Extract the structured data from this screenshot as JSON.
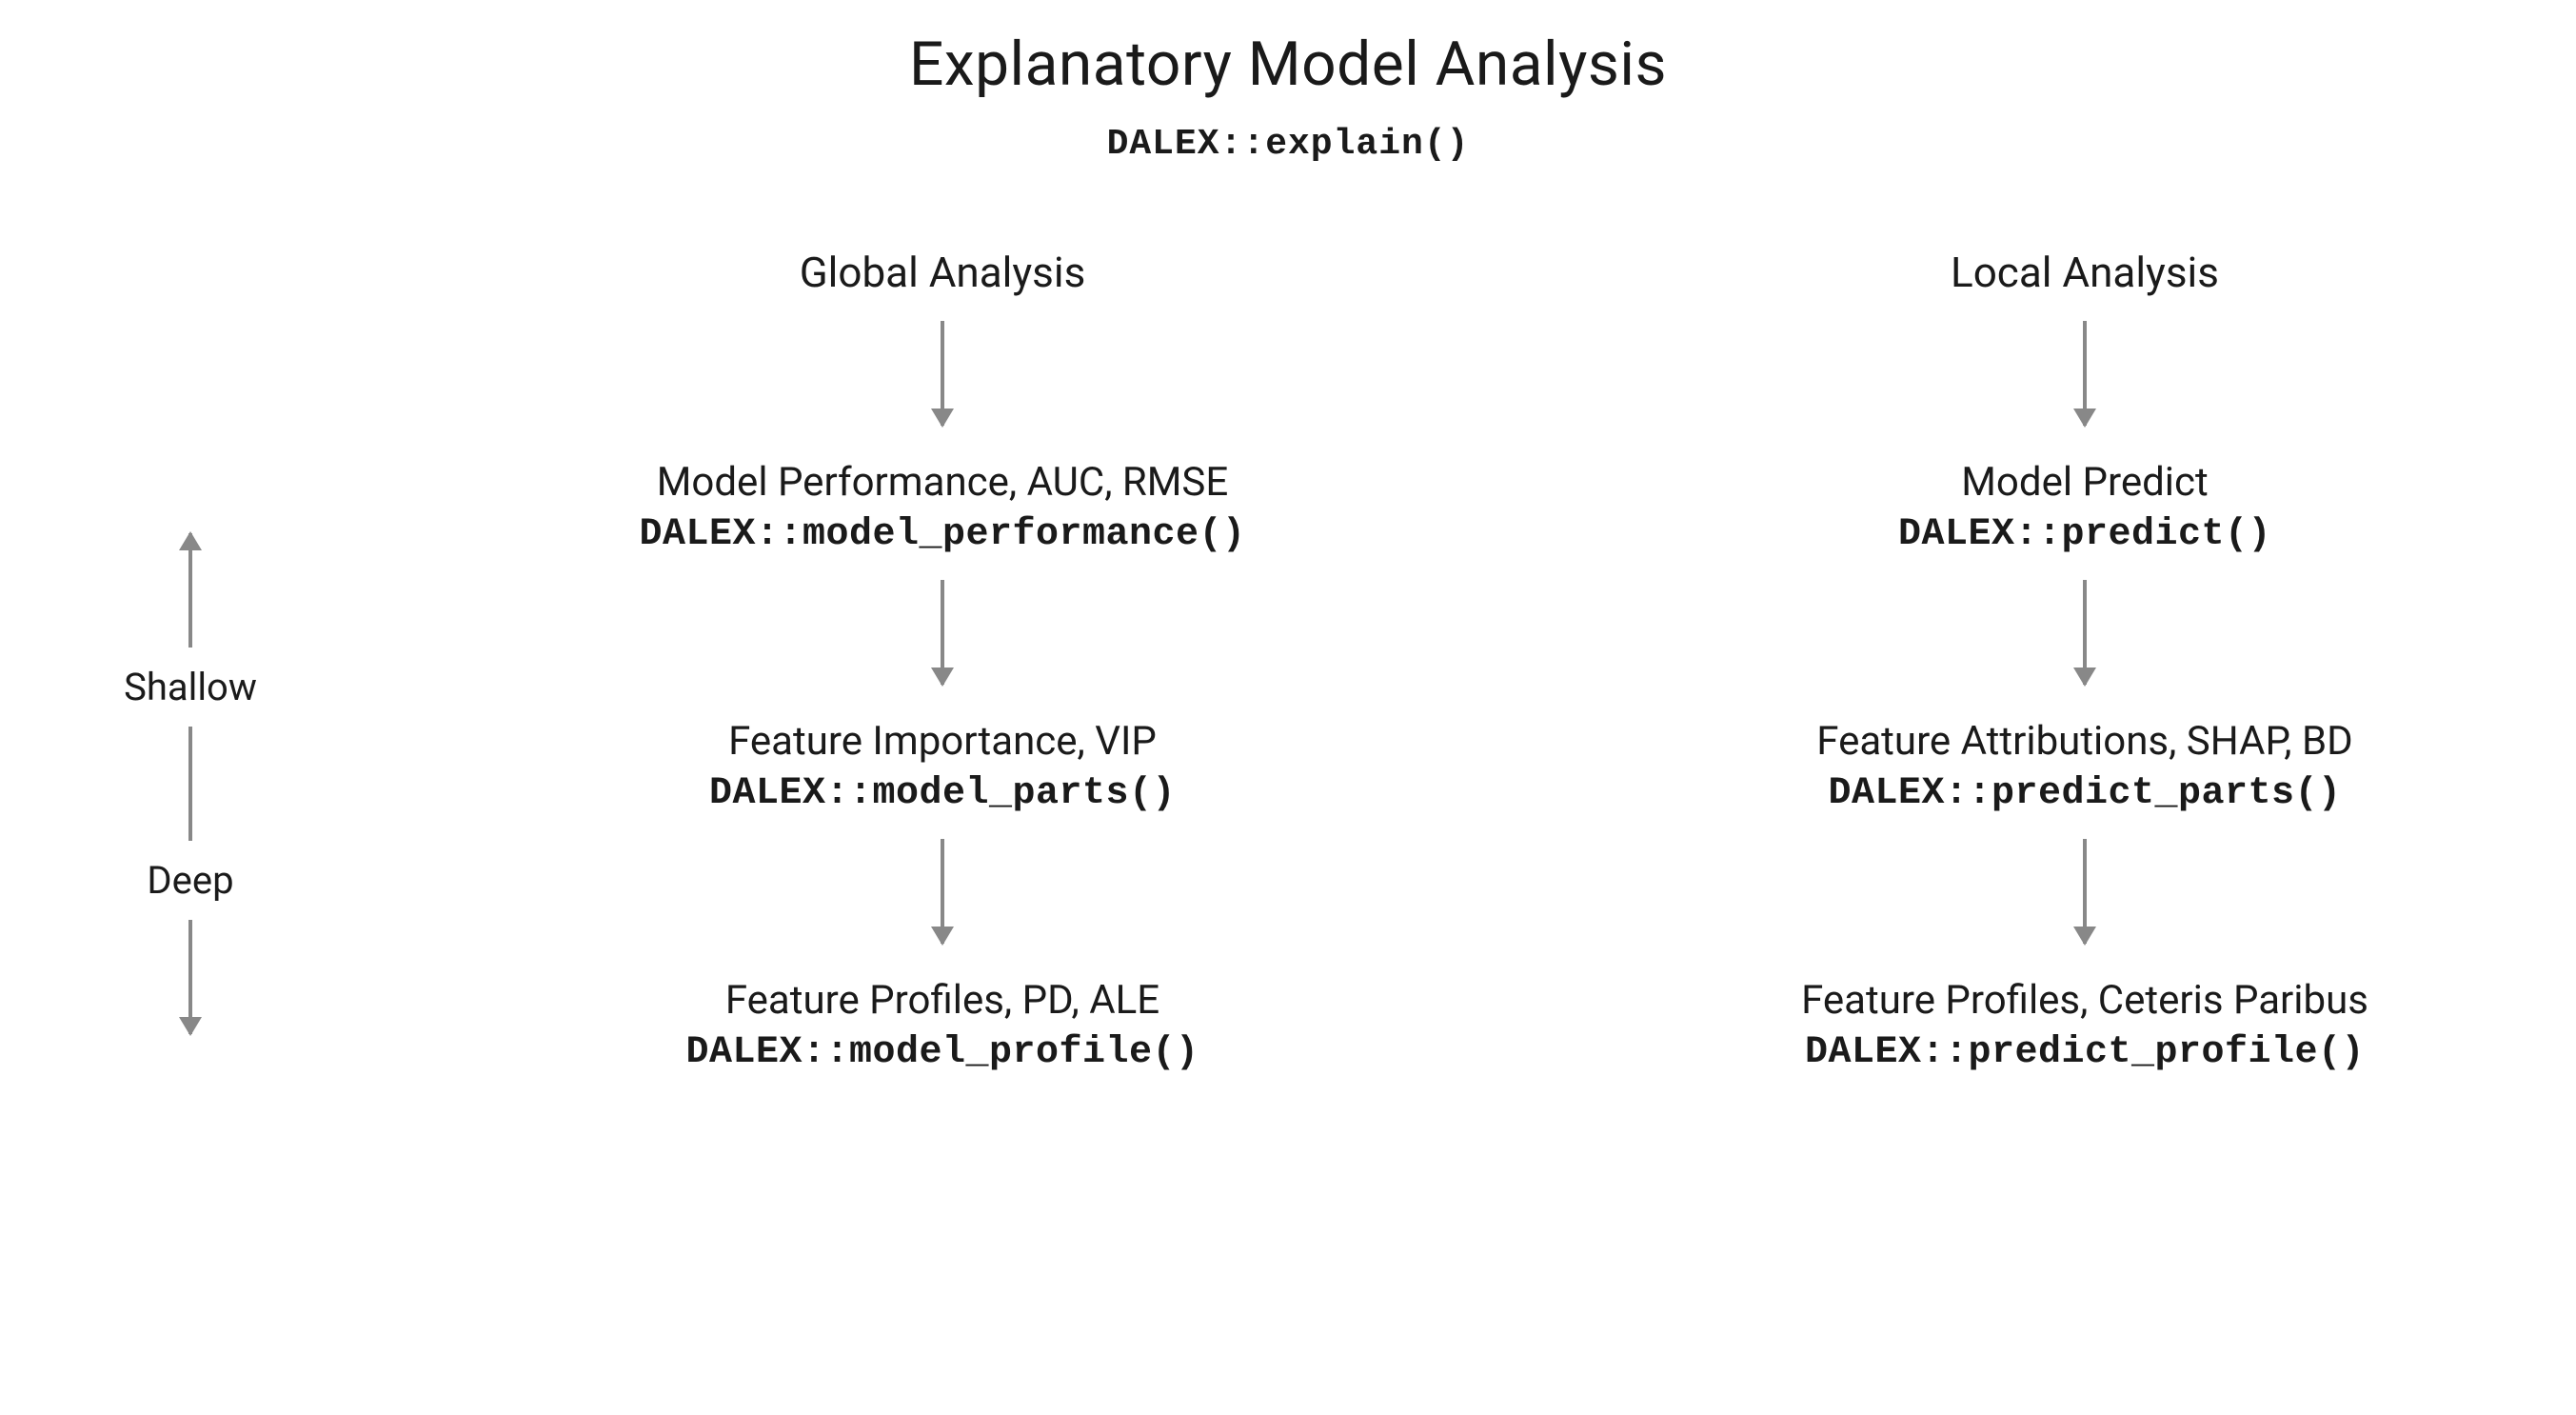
{
  "title": "Explanatory Model Analysis",
  "subtitle": "DALEX::explain()",
  "axis": {
    "shallow": "Shallow",
    "deep": "Deep"
  },
  "columns": {
    "global": {
      "heading": "Global Analysis",
      "nodes": [
        {
          "label": "Model Performance, AUC, RMSE",
          "code": "DALEX::model_performance()"
        },
        {
          "label": "Feature Importance, VIP",
          "code": "DALEX::model_parts()"
        },
        {
          "label": "Feature Profiles, PD, ALE",
          "code": "DALEX::model_profile()"
        }
      ]
    },
    "local": {
      "heading": "Local  Analysis",
      "nodes": [
        {
          "label": "Model Predict",
          "code": "DALEX::predict()"
        },
        {
          "label": "Feature Attributions, SHAP, BD",
          "code": "DALEX::predict_parts()"
        },
        {
          "label": "Feature Profiles, Ceteris Paribus",
          "code": "DALEX::predict_profile()"
        }
      ]
    }
  }
}
